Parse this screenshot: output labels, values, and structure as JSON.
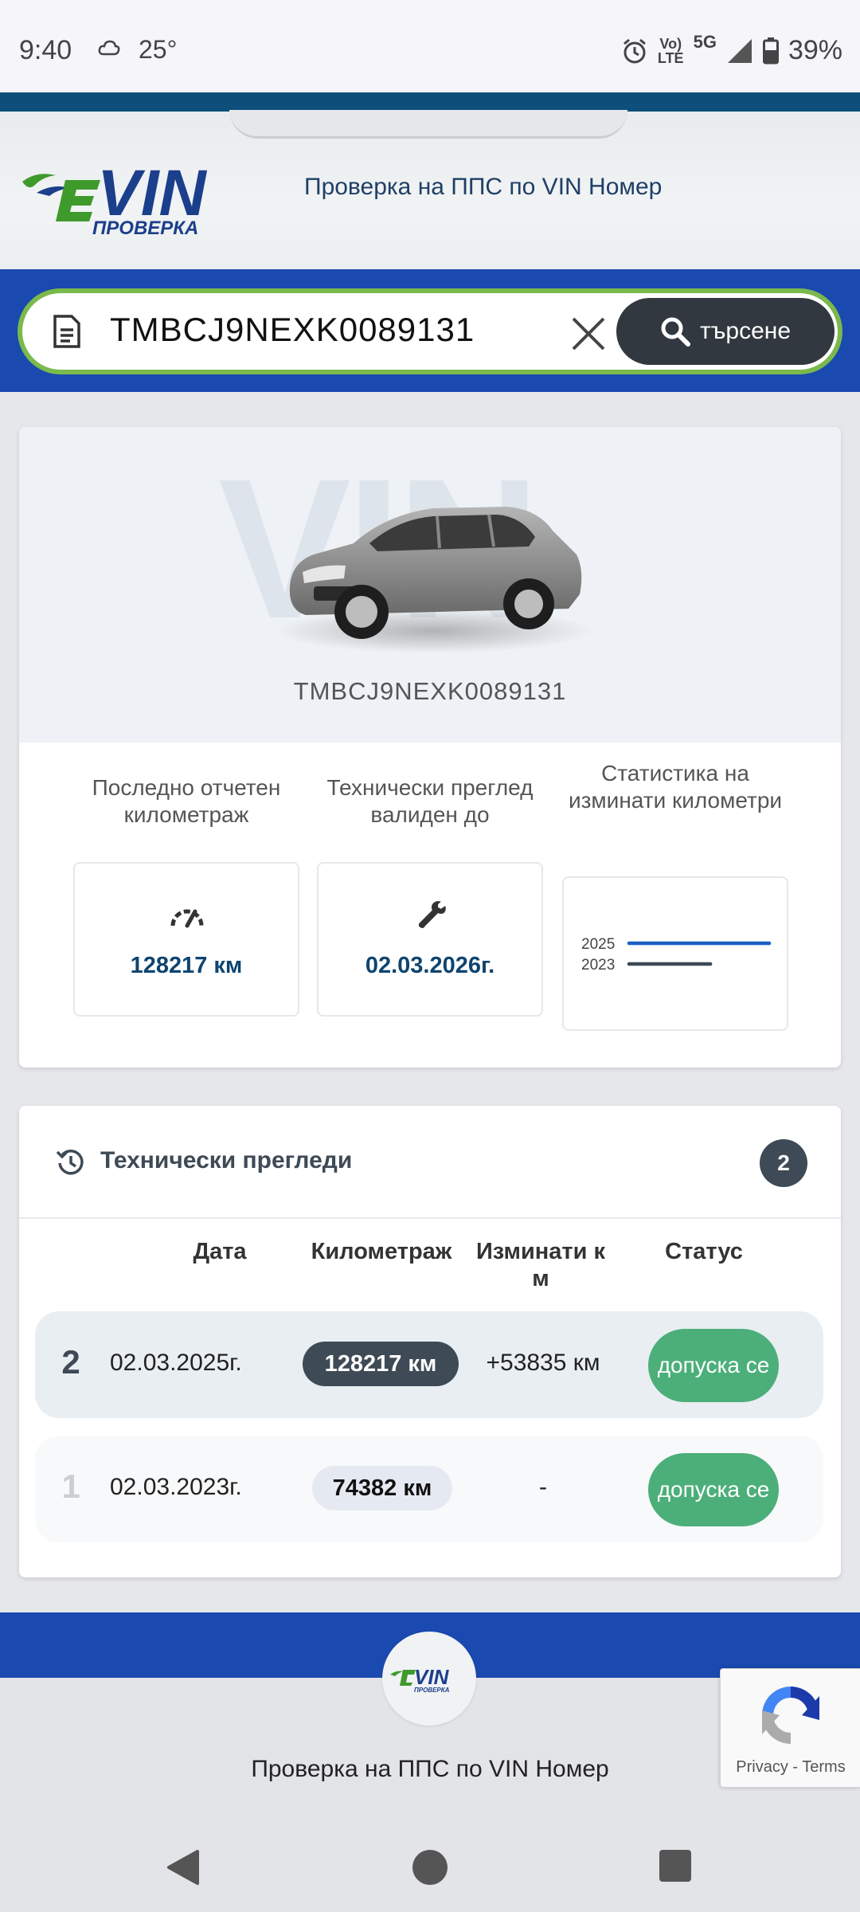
{
  "status_bar": {
    "time": "9:40",
    "temperature": "25°",
    "volte_top": "Vo)",
    "volte_bottom": "LTE",
    "network": "5G",
    "battery": "39%"
  },
  "header": {
    "title": "Проверка на ППС по VIN Номер",
    "logo_text": "VIN",
    "logo_subtext": "ПРОВЕРКА"
  },
  "search": {
    "value": "TMBCJ9NEXK0089131",
    "button_label": "търсене"
  },
  "vehicle": {
    "watermark": "VIN",
    "vin": "TMBCJ9NEXK0089131",
    "stats": [
      {
        "label": "Последно отчетен километраж",
        "value": "128217 км",
        "icon": "speedometer-icon"
      },
      {
        "label": "Технически преглед валиден до",
        "value": "02.03.2026г.",
        "icon": "wrench-icon"
      },
      {
        "label": "Статистика на изминати километри",
        "icon": "mini-chart"
      }
    ]
  },
  "chart_data": {
    "type": "bar",
    "orientation": "horizontal",
    "categories": [
      "2025",
      "2023"
    ],
    "values": [
      128217,
      74382
    ],
    "colors": [
      "#1b5fc4",
      "#3e4a55"
    ]
  },
  "inspections": {
    "title": "Технически прегледи",
    "count": "2",
    "columns": [
      "Дата",
      "Километраж",
      "Изминати к м",
      "Статус"
    ],
    "rows": [
      {
        "no": "2",
        "date": "02.03.2025г.",
        "km": "128217 км",
        "diff": "+53835 км",
        "status": "допуска се"
      },
      {
        "no": "1",
        "date": "02.03.2023г.",
        "km": "74382 км",
        "diff": "-",
        "status": "допуска се"
      }
    ]
  },
  "footer": {
    "text": "Проверка на ППС по VIN Номер"
  },
  "recaptcha": {
    "privacy": "Privacy",
    "separator": " - ",
    "terms": "Terms"
  },
  "colors": {
    "brand_blue": "#1a49b0",
    "search_border": "#7ab94b",
    "status_green": "#4caf7a",
    "dark_slate": "#3e4a55"
  }
}
